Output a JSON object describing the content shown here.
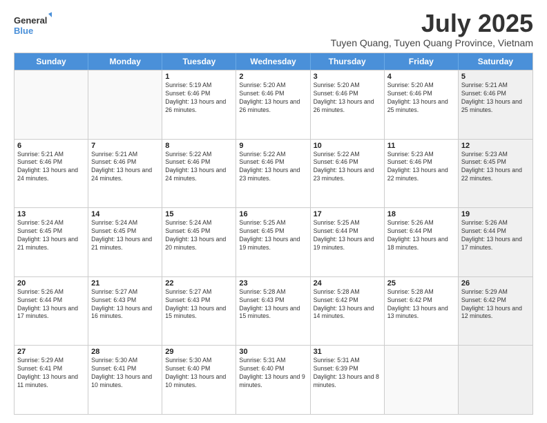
{
  "logo": {
    "line1": "General",
    "line2": "Blue"
  },
  "title": "July 2025",
  "location": "Tuyen Quang, Tuyen Quang Province, Vietnam",
  "days_of_week": [
    "Sunday",
    "Monday",
    "Tuesday",
    "Wednesday",
    "Thursday",
    "Friday",
    "Saturday"
  ],
  "weeks": [
    [
      {
        "day": "",
        "info": "",
        "empty": true
      },
      {
        "day": "",
        "info": "",
        "empty": true
      },
      {
        "day": "1",
        "info": "Sunrise: 5:19 AM\nSunset: 6:46 PM\nDaylight: 13 hours and 26 minutes."
      },
      {
        "day": "2",
        "info": "Sunrise: 5:20 AM\nSunset: 6:46 PM\nDaylight: 13 hours and 26 minutes."
      },
      {
        "day": "3",
        "info": "Sunrise: 5:20 AM\nSunset: 6:46 PM\nDaylight: 13 hours and 26 minutes."
      },
      {
        "day": "4",
        "info": "Sunrise: 5:20 AM\nSunset: 6:46 PM\nDaylight: 13 hours and 25 minutes."
      },
      {
        "day": "5",
        "info": "Sunrise: 5:21 AM\nSunset: 6:46 PM\nDaylight: 13 hours and 25 minutes.",
        "shaded": true
      }
    ],
    [
      {
        "day": "6",
        "info": "Sunrise: 5:21 AM\nSunset: 6:46 PM\nDaylight: 13 hours and 24 minutes."
      },
      {
        "day": "7",
        "info": "Sunrise: 5:21 AM\nSunset: 6:46 PM\nDaylight: 13 hours and 24 minutes."
      },
      {
        "day": "8",
        "info": "Sunrise: 5:22 AM\nSunset: 6:46 PM\nDaylight: 13 hours and 24 minutes."
      },
      {
        "day": "9",
        "info": "Sunrise: 5:22 AM\nSunset: 6:46 PM\nDaylight: 13 hours and 23 minutes."
      },
      {
        "day": "10",
        "info": "Sunrise: 5:22 AM\nSunset: 6:46 PM\nDaylight: 13 hours and 23 minutes."
      },
      {
        "day": "11",
        "info": "Sunrise: 5:23 AM\nSunset: 6:46 PM\nDaylight: 13 hours and 22 minutes."
      },
      {
        "day": "12",
        "info": "Sunrise: 5:23 AM\nSunset: 6:45 PM\nDaylight: 13 hours and 22 minutes.",
        "shaded": true
      }
    ],
    [
      {
        "day": "13",
        "info": "Sunrise: 5:24 AM\nSunset: 6:45 PM\nDaylight: 13 hours and 21 minutes."
      },
      {
        "day": "14",
        "info": "Sunrise: 5:24 AM\nSunset: 6:45 PM\nDaylight: 13 hours and 21 minutes."
      },
      {
        "day": "15",
        "info": "Sunrise: 5:24 AM\nSunset: 6:45 PM\nDaylight: 13 hours and 20 minutes."
      },
      {
        "day": "16",
        "info": "Sunrise: 5:25 AM\nSunset: 6:45 PM\nDaylight: 13 hours and 19 minutes."
      },
      {
        "day": "17",
        "info": "Sunrise: 5:25 AM\nSunset: 6:44 PM\nDaylight: 13 hours and 19 minutes."
      },
      {
        "day": "18",
        "info": "Sunrise: 5:26 AM\nSunset: 6:44 PM\nDaylight: 13 hours and 18 minutes."
      },
      {
        "day": "19",
        "info": "Sunrise: 5:26 AM\nSunset: 6:44 PM\nDaylight: 13 hours and 17 minutes.",
        "shaded": true
      }
    ],
    [
      {
        "day": "20",
        "info": "Sunrise: 5:26 AM\nSunset: 6:44 PM\nDaylight: 13 hours and 17 minutes."
      },
      {
        "day": "21",
        "info": "Sunrise: 5:27 AM\nSunset: 6:43 PM\nDaylight: 13 hours and 16 minutes."
      },
      {
        "day": "22",
        "info": "Sunrise: 5:27 AM\nSunset: 6:43 PM\nDaylight: 13 hours and 15 minutes."
      },
      {
        "day": "23",
        "info": "Sunrise: 5:28 AM\nSunset: 6:43 PM\nDaylight: 13 hours and 15 minutes."
      },
      {
        "day": "24",
        "info": "Sunrise: 5:28 AM\nSunset: 6:42 PM\nDaylight: 13 hours and 14 minutes."
      },
      {
        "day": "25",
        "info": "Sunrise: 5:28 AM\nSunset: 6:42 PM\nDaylight: 13 hours and 13 minutes."
      },
      {
        "day": "26",
        "info": "Sunrise: 5:29 AM\nSunset: 6:42 PM\nDaylight: 13 hours and 12 minutes.",
        "shaded": true
      }
    ],
    [
      {
        "day": "27",
        "info": "Sunrise: 5:29 AM\nSunset: 6:41 PM\nDaylight: 13 hours and 11 minutes."
      },
      {
        "day": "28",
        "info": "Sunrise: 5:30 AM\nSunset: 6:41 PM\nDaylight: 13 hours and 10 minutes."
      },
      {
        "day": "29",
        "info": "Sunrise: 5:30 AM\nSunset: 6:40 PM\nDaylight: 13 hours and 10 minutes."
      },
      {
        "day": "30",
        "info": "Sunrise: 5:31 AM\nSunset: 6:40 PM\nDaylight: 13 hours and 9 minutes."
      },
      {
        "day": "31",
        "info": "Sunrise: 5:31 AM\nSunset: 6:39 PM\nDaylight: 13 hours and 8 minutes."
      },
      {
        "day": "",
        "info": "",
        "empty": true
      },
      {
        "day": "",
        "info": "",
        "empty": true,
        "shaded": true
      }
    ]
  ]
}
